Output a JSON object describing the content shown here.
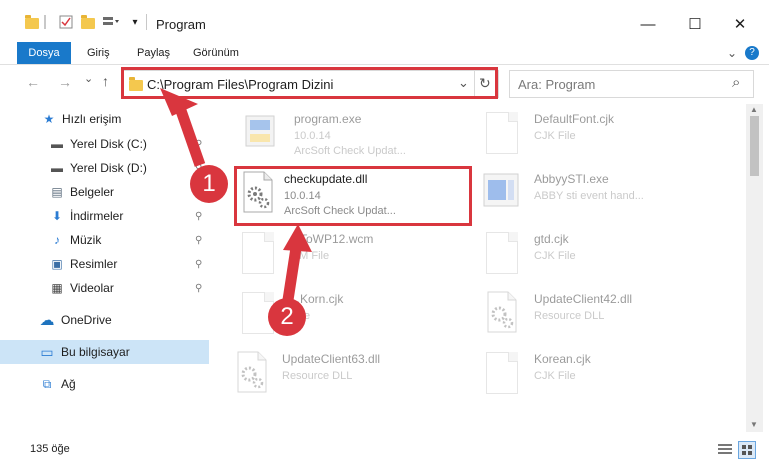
{
  "window": {
    "title": "Program",
    "minimize_glyph": "—",
    "maximize_glyph": "☐",
    "close_glyph": "✕"
  },
  "ribbon": {
    "tabs": [
      "Dosya",
      "Giriş",
      "Paylaş",
      "Görünüm"
    ],
    "expand_glyph": "⌄",
    "help_glyph": "?"
  },
  "nav": {
    "back_glyph": "←",
    "forward_glyph": "→",
    "recent_glyph": "⌄",
    "up_glyph": "↑",
    "address": "C:\\Program Files\\Program Dizini",
    "address_dropdown_glyph": "⌄",
    "refresh_glyph": "↻",
    "search_placeholder": "Ara: Program",
    "search_glyph": "⌕"
  },
  "sidebar": {
    "items": [
      {
        "label": "Hızlı erişim",
        "icon": "star-icon",
        "glyph": "★",
        "color": "#2b7cd3",
        "pinned": false
      },
      {
        "label": "Yerel Disk (C:)",
        "icon": "drive-icon",
        "glyph": "▬",
        "color": "#555555",
        "pinned": true
      },
      {
        "label": "Yerel Disk (D:)",
        "icon": "drive-icon",
        "glyph": "▬",
        "color": "#555555",
        "pinned": true
      },
      {
        "label": "Belgeler",
        "icon": "documents-icon",
        "glyph": "▤",
        "color": "#5a6b7b",
        "pinned": true
      },
      {
        "label": "İndirmeler",
        "icon": "download-icon",
        "glyph": "⬇",
        "color": "#2b7cd3",
        "pinned": true
      },
      {
        "label": "Müzik",
        "icon": "music-icon",
        "glyph": "♪",
        "color": "#2b7cd3",
        "pinned": true
      },
      {
        "label": "Resimler",
        "icon": "pictures-icon",
        "glyph": "▣",
        "color": "#3b6ea5",
        "pinned": true
      },
      {
        "label": "Videolar",
        "icon": "videos-icon",
        "glyph": "▦",
        "color": "#444444",
        "pinned": true
      },
      {
        "label": "OneDrive",
        "icon": "cloud-icon",
        "glyph": "☁",
        "color": "#1e73be",
        "pinned": false
      },
      {
        "label": "Bu bilgisayar",
        "icon": "computer-icon",
        "glyph": "▭",
        "color": "#2b7cd3",
        "pinned": false
      },
      {
        "label": "Ağ",
        "icon": "network-icon",
        "glyph": "⧉",
        "color": "#2b7cd3",
        "pinned": false
      }
    ],
    "pin_glyph": "⚲"
  },
  "files": [
    {
      "name": "program.exe",
      "line2": "10.0.14",
      "line3": "ArcSoft Check Updat...",
      "icon": "exe-icon"
    },
    {
      "name": "DefaultFont.cjk",
      "line2": "CJK File",
      "line3": "",
      "icon": "file-icon"
    },
    {
      "name": "checkupdate.dll",
      "line2": "10.0.14",
      "line3": "ArcSoft Check Updat...",
      "icon": "dll-gear-icon"
    },
    {
      "name": "AbbyySTI.exe",
      "line2": "ABBY sti event hand...",
      "line3": "",
      "icon": "exe-icon"
    },
    {
      "name": "...ToWP12.wcm",
      "line2": "...M File",
      "line3": "",
      "icon": "file-icon"
    },
    {
      "name": "gtd.cjk",
      "line2": "CJK File",
      "line3": "",
      "icon": "file-icon"
    },
    {
      "name": "...Korn.cjk",
      "line2": "...ile",
      "line3": "",
      "icon": "file-icon"
    },
    {
      "name": "UpdateClient42.dll",
      "line2": "Resource DLL",
      "line3": "",
      "icon": "dll-gear-icon"
    },
    {
      "name": "UpdateClient63.dll",
      "line2": "Resource DLL",
      "line3": "",
      "icon": "dll-gear-icon"
    },
    {
      "name": "Korean.cjk",
      "line2": "CJK File",
      "line3": "",
      "icon": "file-icon"
    }
  ],
  "status": {
    "count": "135 öğe"
  },
  "annotations": {
    "callout1": "1",
    "callout2": "2",
    "color": "#d9363e"
  }
}
